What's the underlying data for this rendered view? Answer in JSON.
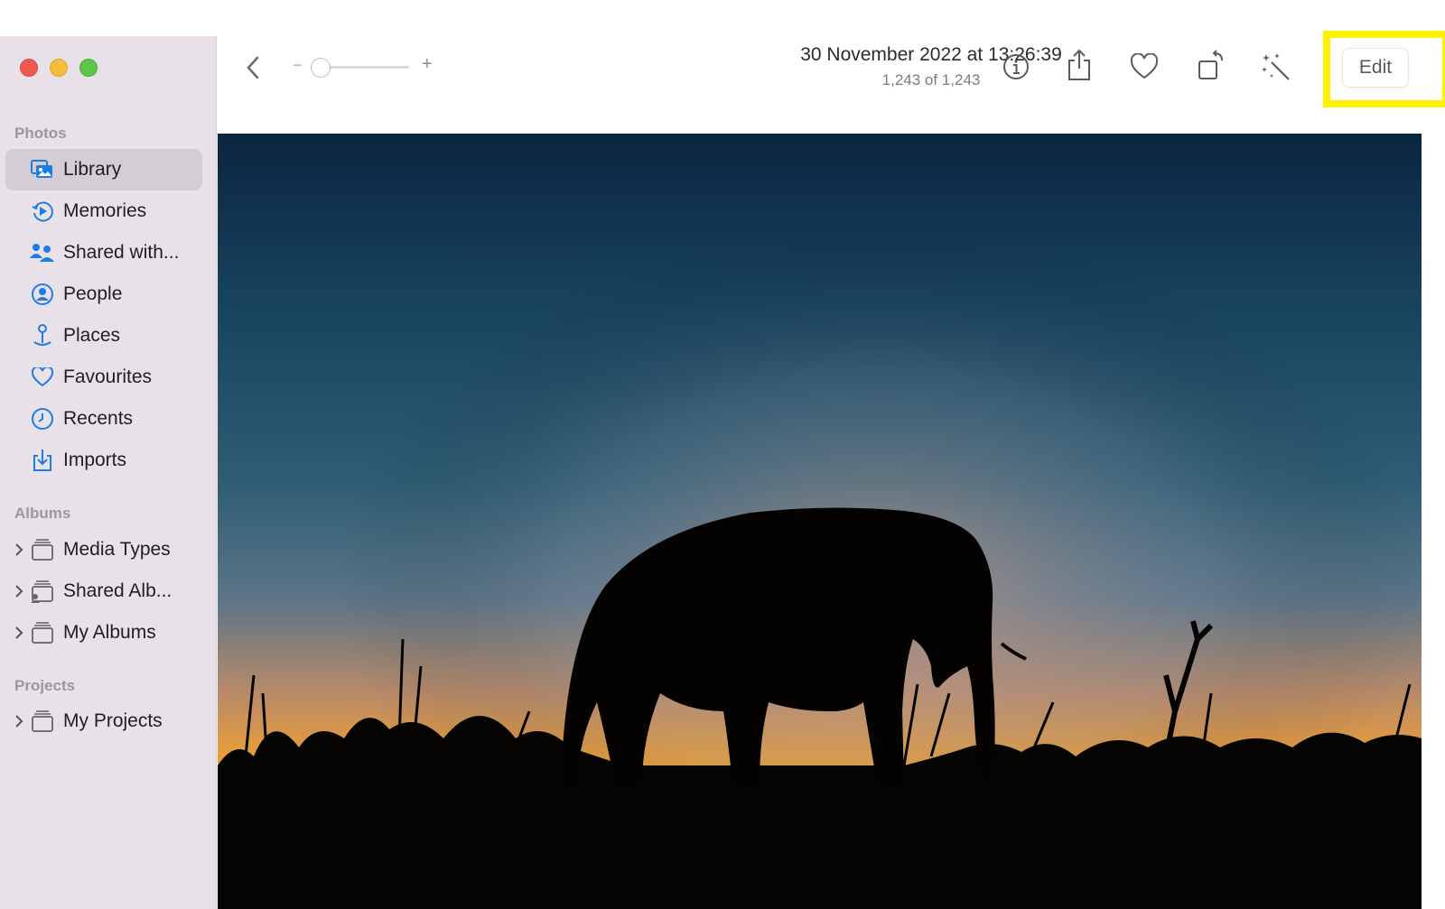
{
  "window": {
    "controls": [
      "close",
      "minimize",
      "maximize"
    ]
  },
  "sidebar": {
    "photos_section": "Photos",
    "items": [
      {
        "label": "Library",
        "icon": "library-icon",
        "selected": true
      },
      {
        "label": "Memories",
        "icon": "memories-icon"
      },
      {
        "label": "Shared with...",
        "icon": "shared-with-you-icon"
      },
      {
        "label": "People",
        "icon": "people-icon"
      },
      {
        "label": "Places",
        "icon": "places-pin-icon"
      },
      {
        "label": "Favourites",
        "icon": "heart-icon"
      },
      {
        "label": "Recents",
        "icon": "clock-icon"
      },
      {
        "label": "Imports",
        "icon": "import-icon"
      }
    ],
    "albums_section": "Albums",
    "albums": [
      {
        "label": "Media Types",
        "icon": "album-stack-icon"
      },
      {
        "label": "Shared Alb...",
        "icon": "shared-album-icon"
      },
      {
        "label": "My Albums",
        "icon": "album-stack-icon"
      }
    ],
    "projects_section": "Projects",
    "projects": [
      {
        "label": "My Projects",
        "icon": "album-stack-icon"
      }
    ]
  },
  "toolbar": {
    "back_icon": "chevron-left-icon",
    "zoom_minus": "−",
    "zoom_plus": "+",
    "zoom_level": 0,
    "title": "30 November 2022 at 13:26:39",
    "subtitle": "1,243 of 1,243",
    "icons": [
      "info-icon",
      "share-icon",
      "heart-icon",
      "rotate-icon",
      "magic-wand-icon"
    ],
    "edit_label": "Edit"
  },
  "colors": {
    "accent": "#1f7ce6",
    "highlight": "#fff200",
    "sidebar_bg": "#e8e2e8"
  }
}
